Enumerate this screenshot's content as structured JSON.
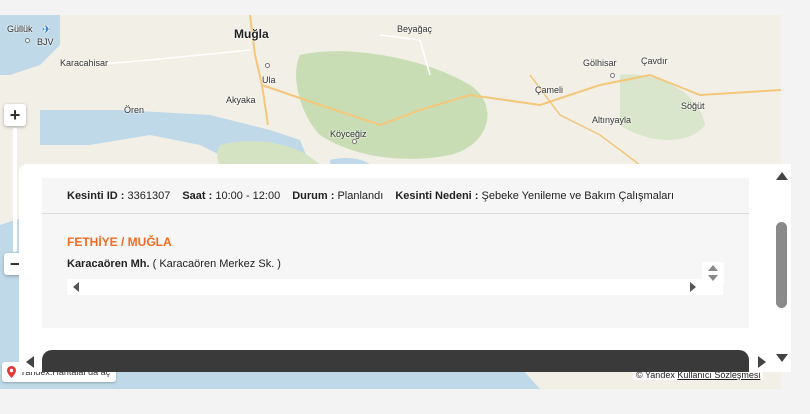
{
  "map": {
    "places": [
      {
        "name": "Güllük",
        "kind": "town"
      },
      {
        "name": "BJV",
        "kind": "airport"
      },
      {
        "name": "Muğla",
        "kind": "city"
      },
      {
        "name": "Beyağaç",
        "kind": "town"
      },
      {
        "name": "Karacahisar",
        "kind": "town"
      },
      {
        "name": "Ula",
        "kind": "town"
      },
      {
        "name": "Gölhisar",
        "kind": "town"
      },
      {
        "name": "Çavdır",
        "kind": "town"
      },
      {
        "name": "Çameli",
        "kind": "town"
      },
      {
        "name": "Ören",
        "kind": "town"
      },
      {
        "name": "Akyaka",
        "kind": "town"
      },
      {
        "name": "Altınyayla",
        "kind": "town"
      },
      {
        "name": "Söğüt",
        "kind": "town"
      },
      {
        "name": "Köyceğiz",
        "kind": "town"
      }
    ],
    "zoom_in_label": "+",
    "zoom_out_label": "−",
    "yandex_badge": "Yandex.Haritalar'da aç",
    "copyright": "© Yandex",
    "terms_link": "Kullanıcı Sözleşmesi"
  },
  "outage": {
    "id_label": "Kesinti ID :",
    "id_value": "3361307",
    "time_label": "Saat :",
    "time_value": "10:00 - 12:00",
    "status_label": "Durum :",
    "status_value": "Planlandı",
    "reason_label": "Kesinti Nedeni :",
    "reason_value": "Şebeke Yenileme ve Bakım Çalışmaları",
    "region": "FETHİYE / MUĞLA",
    "neighborhood": "Karacaören Mh.",
    "streets": "( Karacaören Merkez Sk. )"
  },
  "colors": {
    "accent": "#f26b21",
    "water": "#bfd9e8",
    "land": "#f1efe6",
    "forest": "#c9ddb5"
  }
}
